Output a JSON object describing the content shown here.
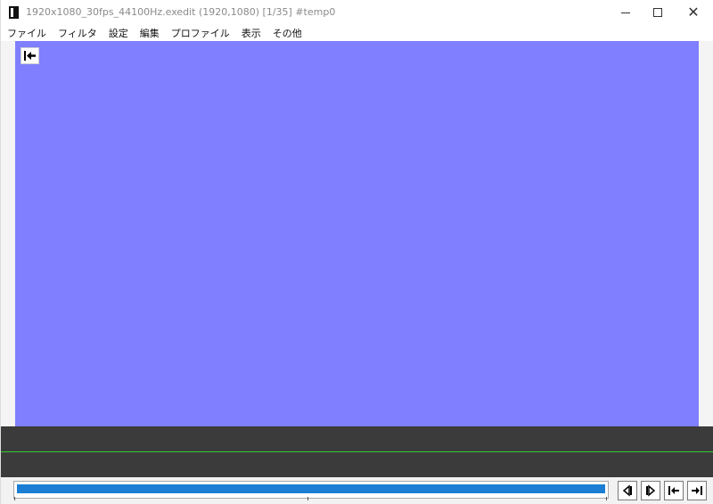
{
  "window": {
    "title": "1920x1080_30fps_44100Hz.exedit (1920,1080)  [1/35]  #temp0",
    "controls": {
      "minimize_glyph": "",
      "maximize_glyph": "",
      "close_glyph": "✕"
    }
  },
  "menu": {
    "items": [
      {
        "label": "ファイル"
      },
      {
        "label": "フィルタ"
      },
      {
        "label": "設定"
      },
      {
        "label": "編集"
      },
      {
        "label": "プロファイル"
      },
      {
        "label": "表示"
      },
      {
        "label": "その他"
      }
    ]
  },
  "preview": {
    "background_color": "#7f7fff",
    "overlay_button_icon": "jump-to-start-icon"
  },
  "timeline": {
    "band_color": "#3b3b3b",
    "marker_color": "#33cc33"
  },
  "seekbar": {
    "progress_fraction": 1.0,
    "fill_color": "#1a7fd4"
  },
  "playback_controls": [
    {
      "icon": "previous-frame-icon"
    },
    {
      "icon": "next-frame-icon"
    },
    {
      "icon": "jump-to-start-icon"
    },
    {
      "icon": "jump-to-end-icon"
    }
  ]
}
